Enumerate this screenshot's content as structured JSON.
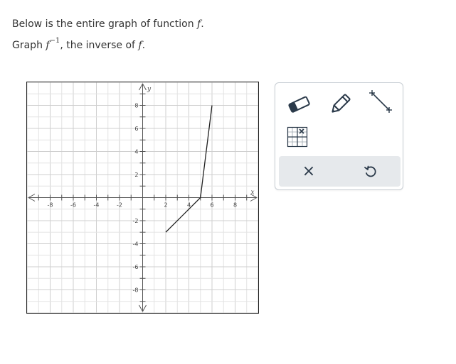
{
  "prompt": {
    "line1_text": "Below is the entire graph of function ",
    "line1_var": "f",
    "line1_end": ".",
    "line2_text1": "Graph ",
    "line2_var": "f",
    "line2_sup": "−1",
    "line2_text2": ", the inverse of ",
    "line2_var2": "f",
    "line2_end": "."
  },
  "chart_data": {
    "type": "line",
    "xlabel": "x",
    "ylabel": "y",
    "xlim": [
      -10,
      10
    ],
    "ylim": [
      -10,
      10
    ],
    "x_tick_labels": [
      "-8",
      "-6",
      "-4",
      "-2",
      "2",
      "4",
      "6",
      "8"
    ],
    "y_tick_labels": [
      "8",
      "6",
      "4",
      "2",
      "-2",
      "-4",
      "-6",
      "-8"
    ],
    "grid": true,
    "series": [
      {
        "points": [
          [
            2,
            -3
          ],
          [
            5,
            0
          ],
          [
            6,
            8
          ]
        ]
      }
    ]
  },
  "tools": {
    "eraser": "eraser-icon",
    "pencil": "pencil-icon",
    "segment": "line-segment-icon",
    "grid": "grid-point-icon",
    "clear": "×",
    "undo": "undo-icon"
  },
  "colors": {
    "grid_minor": "#e3e3e3",
    "grid_major": "#cfcfcf",
    "axis": "#555555",
    "curve": "#222222",
    "icon": "#2b3a4a",
    "action_bg": "#e6e9ec"
  }
}
